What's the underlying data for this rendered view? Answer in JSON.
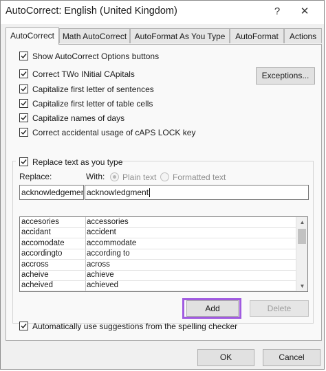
{
  "window": {
    "title": "AutoCorrect: English (United Kingdom)",
    "help_glyph": "?",
    "close_glyph": "✕"
  },
  "tabs": [
    {
      "label": "AutoCorrect",
      "active": true
    },
    {
      "label": "Math AutoCorrect",
      "active": false
    },
    {
      "label": "AutoFormat As You Type",
      "active": false
    },
    {
      "label": "AutoFormat",
      "active": false
    },
    {
      "label": "Actions",
      "active": false
    }
  ],
  "options": {
    "show_buttons": {
      "label": "Show AutoCorrect Options buttons",
      "checked": true
    },
    "two_initial_caps": {
      "label": "Correct TWo INitial CApitals",
      "checked": true
    },
    "first_letter_sentences": {
      "label": "Capitalize first letter of sentences",
      "checked": true
    },
    "first_letter_table_cells": {
      "label": "Capitalize first letter of table cells",
      "checked": true
    },
    "names_of_days": {
      "label": "Capitalize names of days",
      "checked": true
    },
    "caps_lock": {
      "label": "Correct accidental usage of cAPS LOCK key",
      "checked": true
    }
  },
  "exceptions_button": "Exceptions...",
  "replace_group": {
    "toggle_label": "Replace text as you type",
    "checked": true,
    "replace_label": "Replace:",
    "with_label": "With:",
    "plain_text_label": "Plain text",
    "formatted_text_label": "Formatted text",
    "replace_value": "acknowledgement",
    "with_value": "acknowledgment"
  },
  "entries": [
    {
      "replace": "accesories",
      "with": "accessories"
    },
    {
      "replace": "accidant",
      "with": "accident"
    },
    {
      "replace": "accomodate",
      "with": "accommodate"
    },
    {
      "replace": "accordingto",
      "with": "according to"
    },
    {
      "replace": "accross",
      "with": "across"
    },
    {
      "replace": "acheive",
      "with": "achieve"
    },
    {
      "replace": "acheived",
      "with": "achieved"
    }
  ],
  "scrollbar": {
    "up_glyph": "▲",
    "down_glyph": "▼"
  },
  "add_button": "Add",
  "delete_button": "Delete",
  "spelling_suggestions": {
    "label": "Automatically use suggestions from the spelling checker",
    "checked": true
  },
  "ok_button": "OK",
  "cancel_button": "Cancel",
  "colors": {
    "highlight": "#a05be0"
  }
}
